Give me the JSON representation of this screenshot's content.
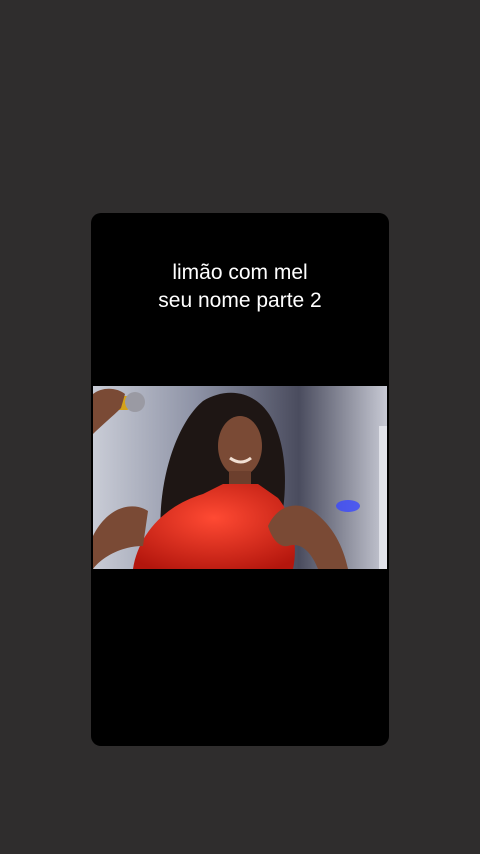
{
  "overlay": {
    "caption_line1": "limão com mel",
    "caption_line2": "seu nome parte 2"
  },
  "video": {
    "frame_description_icon": "performer-image"
  },
  "colors": {
    "background": "#2f2d2d",
    "card": "#000000",
    "caption_text": "#ffffff",
    "dress": "#d8231a"
  }
}
